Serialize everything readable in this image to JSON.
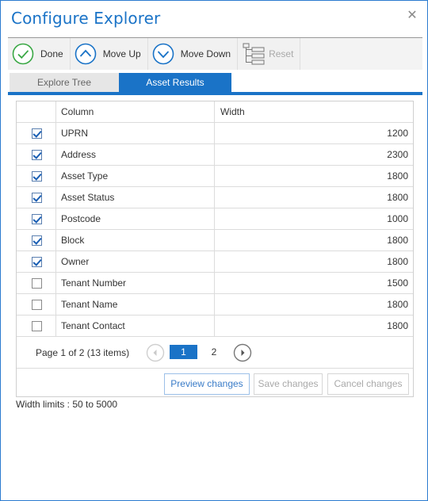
{
  "dialog": {
    "title": "Configure Explorer"
  },
  "toolbar": {
    "done_label": "Done",
    "move_up_label": "Move Up",
    "move_down_label": "Move Down",
    "reset_label": "Reset"
  },
  "tabs": [
    {
      "label": "Explore Tree",
      "active": false
    },
    {
      "label": "Asset Results",
      "active": true
    }
  ],
  "grid": {
    "headers": {
      "column": "Column",
      "width": "Width"
    },
    "rows": [
      {
        "name": "UPRN",
        "width": "1200",
        "checked": true
      },
      {
        "name": "Address",
        "width": "2300",
        "checked": true
      },
      {
        "name": "Asset Type",
        "width": "1800",
        "checked": true
      },
      {
        "name": "Asset Status",
        "width": "1800",
        "checked": true
      },
      {
        "name": "Postcode",
        "width": "1000",
        "checked": true
      },
      {
        "name": "Block",
        "width": "1800",
        "checked": true
      },
      {
        "name": "Owner",
        "width": "1800",
        "checked": true
      },
      {
        "name": "Tenant Number",
        "width": "1500",
        "checked": false
      },
      {
        "name": "Tenant Name",
        "width": "1800",
        "checked": false
      },
      {
        "name": "Tenant Contact",
        "width": "1800",
        "checked": false
      }
    ]
  },
  "pager": {
    "info": "Page 1 of 2 (13 items)",
    "current_page": "1",
    "next_page": "2"
  },
  "actions": {
    "preview_label": "Preview changes",
    "save_label": "Save changes",
    "cancel_label": "Cancel changes"
  },
  "footer": {
    "limits_text": "Width limits : 50 to 5000"
  },
  "colors": {
    "accent": "#1a73c7",
    "done_icon": "#3aa845",
    "arrow_icon": "#1a73c7"
  }
}
